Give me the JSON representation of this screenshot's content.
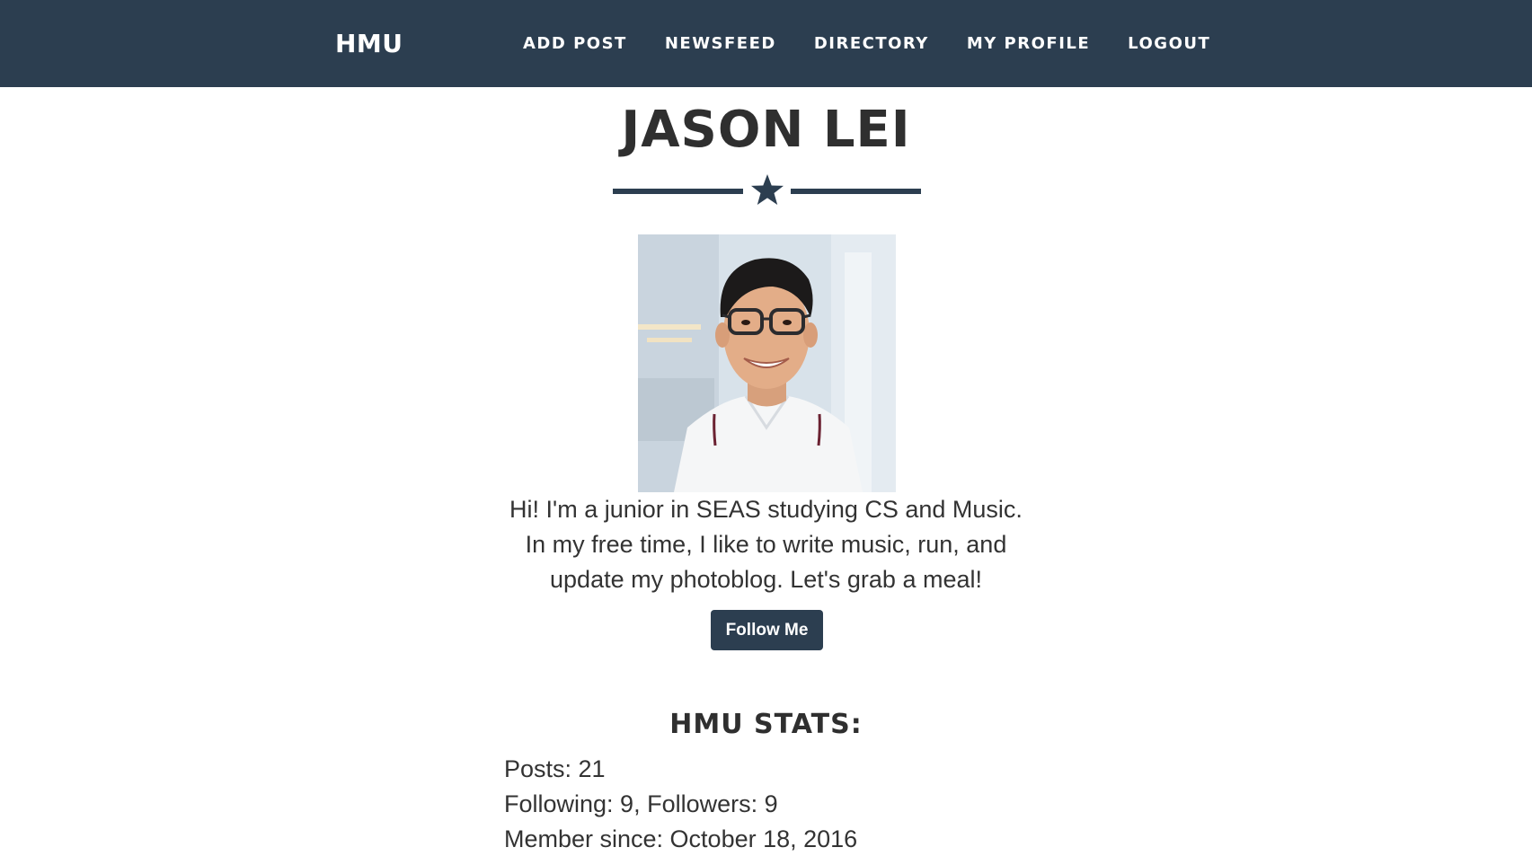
{
  "nav": {
    "brand": "HMU",
    "items": [
      {
        "label": "ADD POST"
      },
      {
        "label": "NEWSFEED"
      },
      {
        "label": "DIRECTORY"
      },
      {
        "label": "MY PROFILE"
      },
      {
        "label": "LOGOUT"
      }
    ]
  },
  "profile": {
    "name": "JASON LEI",
    "divider_icon": "star-icon",
    "avatar_icon": "profile-photo",
    "bio": "Hi! I'm a junior in SEAS studying CS and Music. In my free time, I like to write music, run, and update my photoblog. Let's grab a meal!",
    "follow_label": "Follow Me"
  },
  "stats": {
    "heading": "HMU STATS:",
    "lines": [
      "Posts: 21",
      "Following: 9, Followers: 9",
      "Member since: October 18, 2016"
    ]
  },
  "colors": {
    "navbar": "#2c3e50",
    "accent": "#2c3e50",
    "text": "#333333"
  }
}
